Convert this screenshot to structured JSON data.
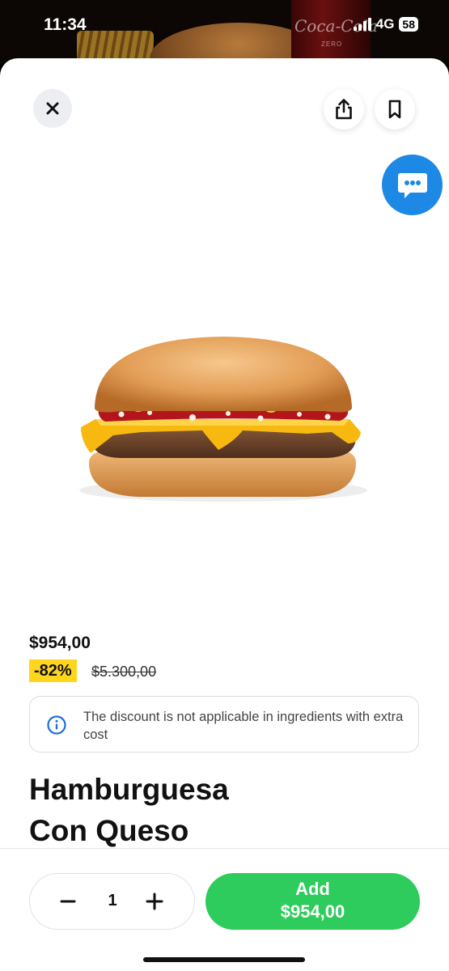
{
  "status_bar": {
    "time": "11:34",
    "network": "4G",
    "battery": "58"
  },
  "background": {
    "can_brand": "Coca-Cola",
    "can_sub": "ZERO"
  },
  "icons": {
    "close": "close-icon",
    "share": "share-icon",
    "bookmark": "bookmark-icon",
    "chat": "chat-icon",
    "info": "info-icon",
    "minus": "minus-icon",
    "plus": "plus-icon"
  },
  "product": {
    "price": "$954,00",
    "discount": "-82%",
    "original_price": "$5.300,00",
    "title_line1": "Hamburguesa",
    "title_line2": "Con Queso"
  },
  "info_notice": {
    "text": "The discount is not applicable in ingredients with extra cost"
  },
  "footer": {
    "quantity": "1",
    "add_label": "Add",
    "add_price": "$954,00"
  },
  "colors": {
    "accent_green": "#2ecc5c",
    "chat_blue": "#1e88e5",
    "discount_yellow": "#ffd51e"
  }
}
